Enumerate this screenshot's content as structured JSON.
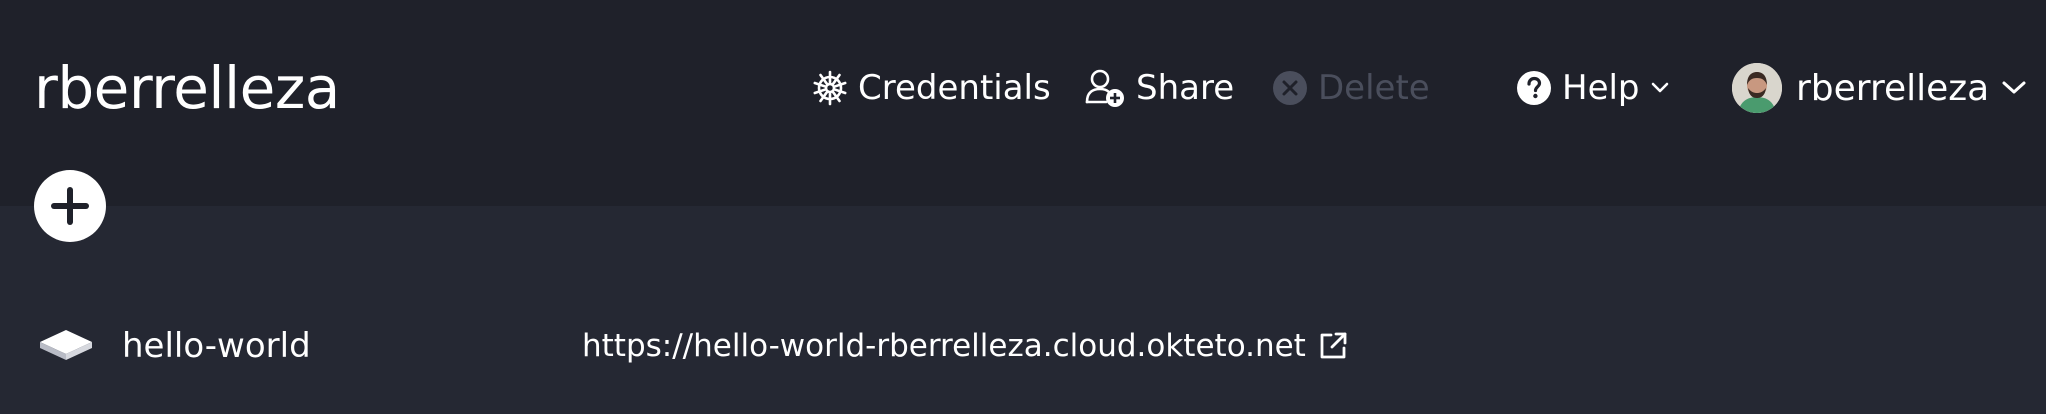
{
  "header": {
    "title": "rberrelleza",
    "actions": {
      "credentials": {
        "label": "Credentials",
        "icon": "helm-wheel-icon"
      },
      "share": {
        "label": "Share",
        "icon": "user-plus-icon"
      },
      "delete": {
        "label": "Delete",
        "icon": "close-circle-icon",
        "disabled": true
      },
      "help": {
        "label": "Help",
        "icon": "question-circle-icon"
      }
    },
    "user": {
      "name": "rberrelleza"
    }
  },
  "add_button": {
    "icon": "plus-icon"
  },
  "deployments": [
    {
      "name": "hello-world",
      "url": "https://hello-world-rberrelleza.cloud.okteto.net",
      "icon": "layer-icon"
    }
  ],
  "colors": {
    "header_bg": "#1f212a",
    "content_bg": "#252833",
    "text": "#ffffff",
    "disabled": "#4a4e5c"
  }
}
